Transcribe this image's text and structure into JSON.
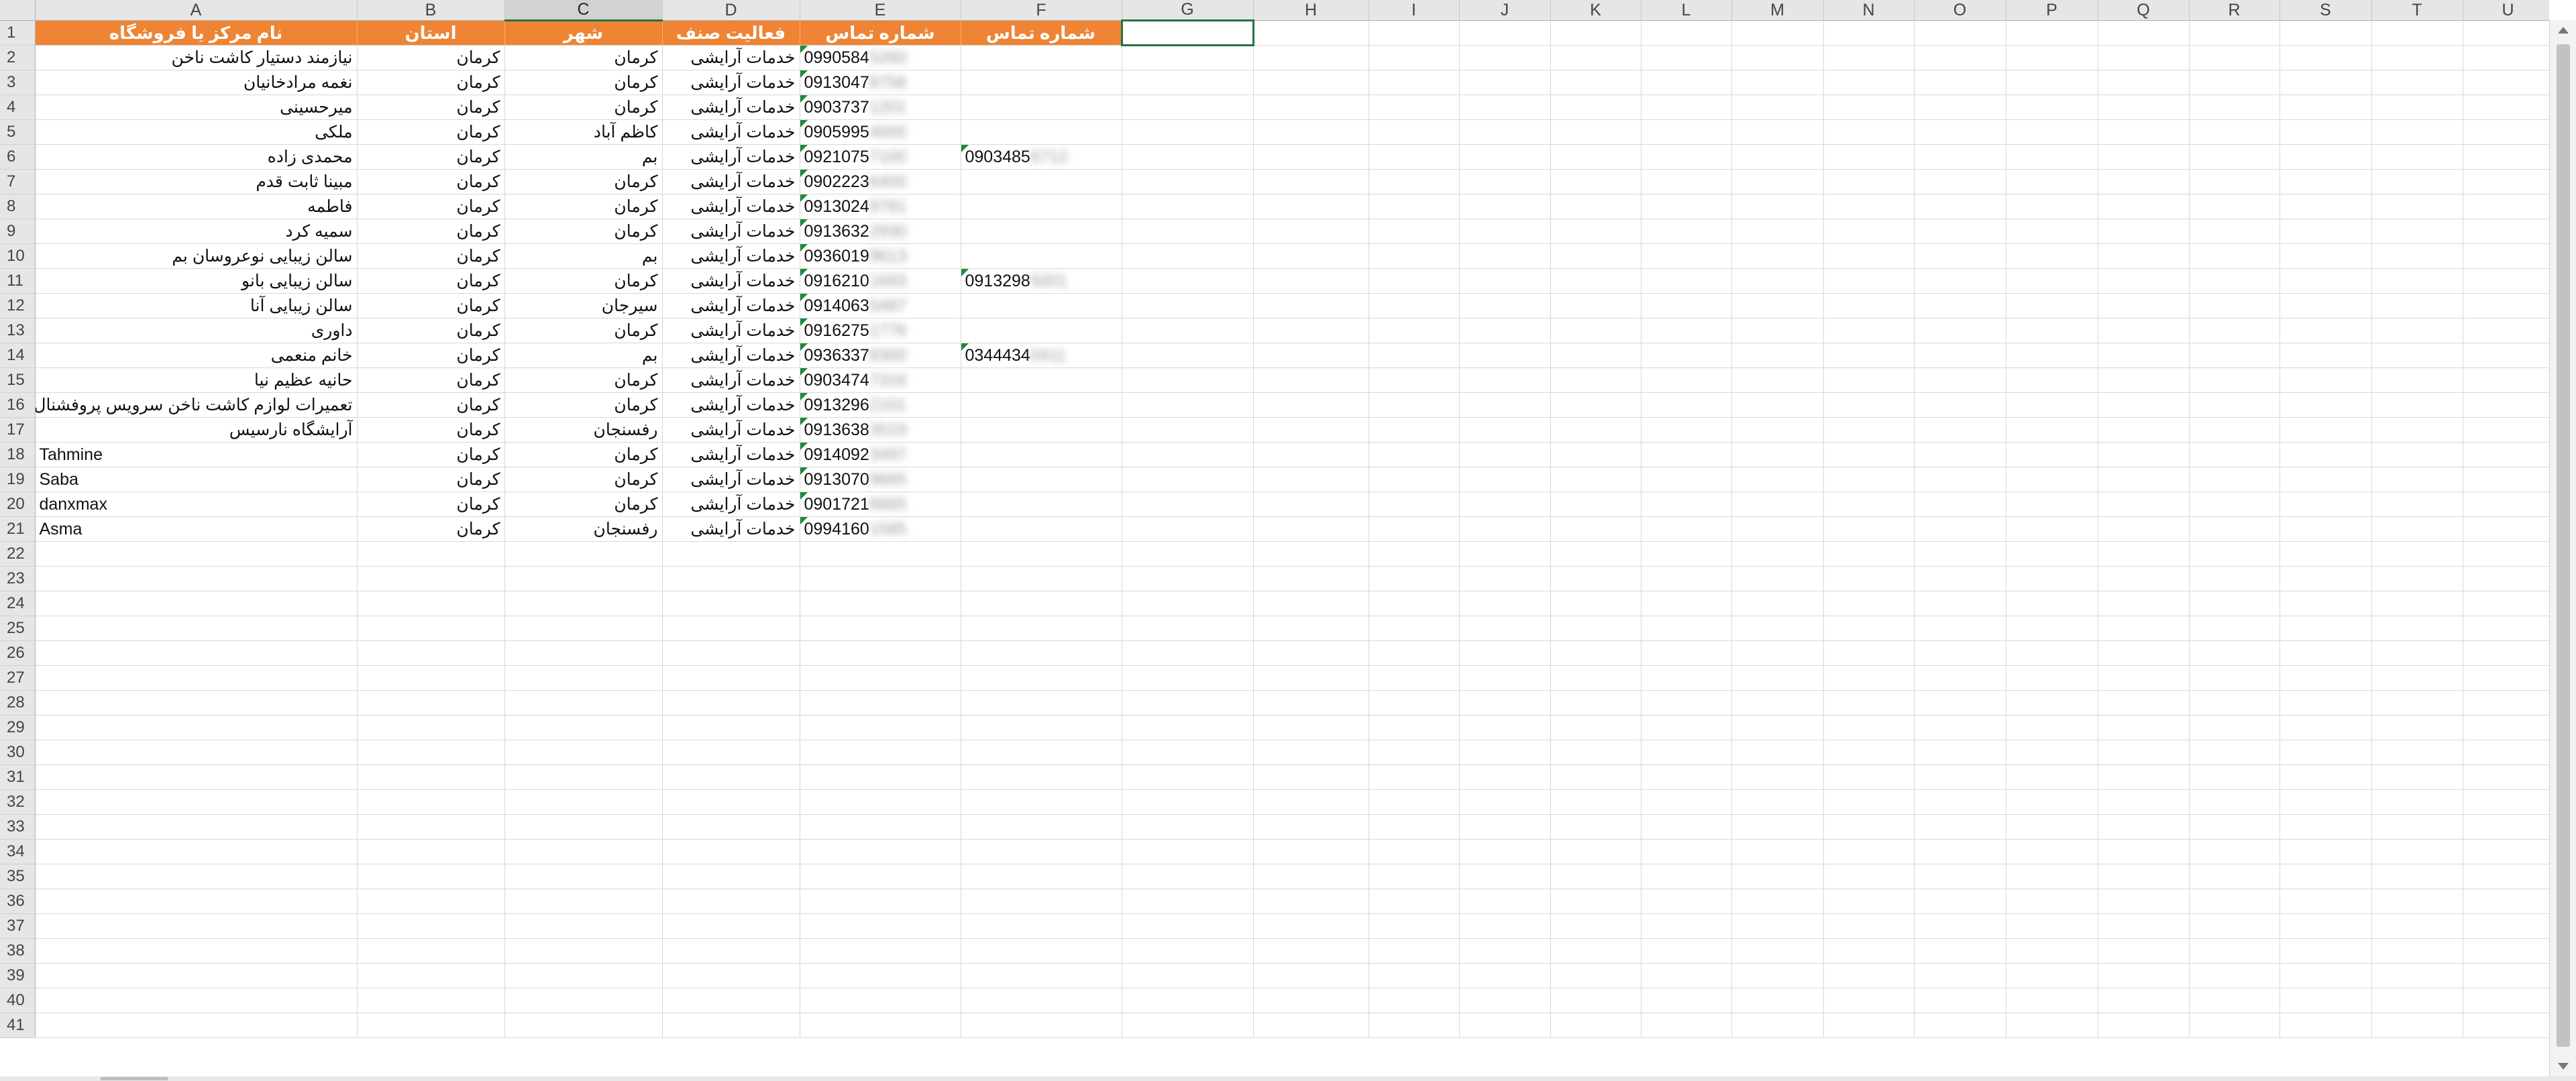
{
  "columns": [
    "A",
    "B",
    "C",
    "D",
    "E",
    "F",
    "G",
    "H",
    "I",
    "J",
    "K",
    "L",
    "M",
    "N",
    "O",
    "P",
    "Q",
    "R",
    "S",
    "T",
    "U"
  ],
  "selected_column": "C",
  "header": {
    "A": "نام مرکز یا فروشگاه",
    "B": "استان",
    "C": "شهر",
    "D": "فعالیت صنف",
    "E": "شماره تماس",
    "F": "شماره تماس"
  },
  "rows": [
    {
      "name": "نیازمند دستیار کاشت ناخن",
      "province": "کرمان",
      "city": "کرمان",
      "activity": "خدمات آرایشی",
      "phone": "0990584",
      "phone_hidden": "5260",
      "phone2": "",
      "phone2_hidden": ""
    },
    {
      "name": "نغمه مرادخانیان",
      "province": "کرمان",
      "city": "کرمان",
      "activity": "خدمات آرایشی",
      "phone": "0913047",
      "phone_hidden": "8756",
      "phone2": "",
      "phone2_hidden": ""
    },
    {
      "name": "میرحسینی",
      "province": "کرمان",
      "city": "کرمان",
      "activity": "خدمات آرایشی",
      "phone": "0903737",
      "phone_hidden": "1201",
      "phone2": "",
      "phone2_hidden": ""
    },
    {
      "name": "ملکی",
      "province": "کرمان",
      "city": "کاظم آباد",
      "activity": "خدمات آرایشی",
      "phone": "0905995",
      "phone_hidden": "4000",
      "phone2": "",
      "phone2_hidden": ""
    },
    {
      "name": "محمدی زاده",
      "province": "کرمان",
      "city": "بم",
      "activity": "خدمات آرایشی",
      "phone": "0921075",
      "phone_hidden": "7100",
      "phone2": "0903485",
      "phone2_hidden": "6712"
    },
    {
      "name": "مبینا ثابت قدم",
      "province": "کرمان",
      "city": "کرمان",
      "activity": "خدمات آرایشی",
      "phone": "0902223",
      "phone_hidden": "6400",
      "phone2": "",
      "phone2_hidden": ""
    },
    {
      "name": "فاطمه",
      "province": "کرمان",
      "city": "کرمان",
      "activity": "خدمات آرایشی",
      "phone": "0913024",
      "phone_hidden": "9781",
      "phone2": "",
      "phone2_hidden": ""
    },
    {
      "name": "سمیه کرد",
      "province": "کرمان",
      "city": "کرمان",
      "activity": "خدمات آرایشی",
      "phone": "0913632",
      "phone_hidden": "2930",
      "phone2": "",
      "phone2_hidden": ""
    },
    {
      "name": "سالن زیبایی نوعروسان بم",
      "province": "کرمان",
      "city": "بم",
      "activity": "خدمات آرایشی",
      "phone": "0936019",
      "phone_hidden": "9613",
      "phone2": "",
      "phone2_hidden": ""
    },
    {
      "name": "سالن زیبایی بانو",
      "province": "کرمان",
      "city": "کرمان",
      "activity": "خدمات آرایشی",
      "phone": "0916210",
      "phone_hidden": "1693",
      "phone2": "0913298",
      "phone2_hidden": "5001"
    },
    {
      "name": "سالن زیبایی آنا",
      "province": "کرمان",
      "city": "سیرجان",
      "activity": "خدمات آرایشی",
      "phone": "0914063",
      "phone_hidden": "5487",
      "phone2": "",
      "phone2_hidden": ""
    },
    {
      "name": "داوری",
      "province": "کرمان",
      "city": "کرمان",
      "activity": "خدمات آرایشی",
      "phone": "0916275",
      "phone_hidden": "1776",
      "phone2": "",
      "phone2_hidden": ""
    },
    {
      "name": "خانم منعمی",
      "province": "کرمان",
      "city": "بم",
      "activity": "خدمات آرایشی",
      "phone": "0936337",
      "phone_hidden": "8300",
      "phone2": "0344434",
      "phone2_hidden": "0411"
    },
    {
      "name": "حانیه عظیم نیا",
      "province": "کرمان",
      "city": "کرمان",
      "activity": "خدمات آرایشی",
      "phone": "0903474",
      "phone_hidden": "7316",
      "phone2": "",
      "phone2_hidden": ""
    },
    {
      "name": "تعمیرات لوازم کاشت ناخن سرویس پروفشنال",
      "province": "کرمان",
      "city": "کرمان",
      "activity": "خدمات آرایشی",
      "phone": "0913296",
      "phone_hidden": "2101",
      "phone2": "",
      "phone2_hidden": ""
    },
    {
      "name": "آرایشگاه نارسیس",
      "province": "کرمان",
      "city": "رفسنجان",
      "activity": "خدمات آرایشی",
      "phone": "0913638",
      "phone_hidden": "3519",
      "phone2": "",
      "phone2_hidden": ""
    },
    {
      "name": "Tahmine",
      "province": "کرمان",
      "city": "کرمان",
      "activity": "خدمات آرایشی",
      "phone": "0914092",
      "phone_hidden": "3497",
      "phone2": "",
      "phone2_hidden": ""
    },
    {
      "name": "Saba",
      "province": "کرمان",
      "city": "کرمان",
      "activity": "خدمات آرایشی",
      "phone": "0913070",
      "phone_hidden": "9665",
      "phone2": "",
      "phone2_hidden": ""
    },
    {
      "name": "danxmax",
      "province": "کرمان",
      "city": "کرمان",
      "activity": "خدمات آرایشی",
      "phone": "0901721",
      "phone_hidden": "6665",
      "phone2": "",
      "phone2_hidden": ""
    },
    {
      "name": "Asma",
      "province": "کرمان",
      "city": "رفسنجان",
      "activity": "خدمات آرایشی",
      "phone": "0994160",
      "phone_hidden": "1585",
      "phone2": "",
      "phone2_hidden": ""
    }
  ],
  "total_rows": 41
}
